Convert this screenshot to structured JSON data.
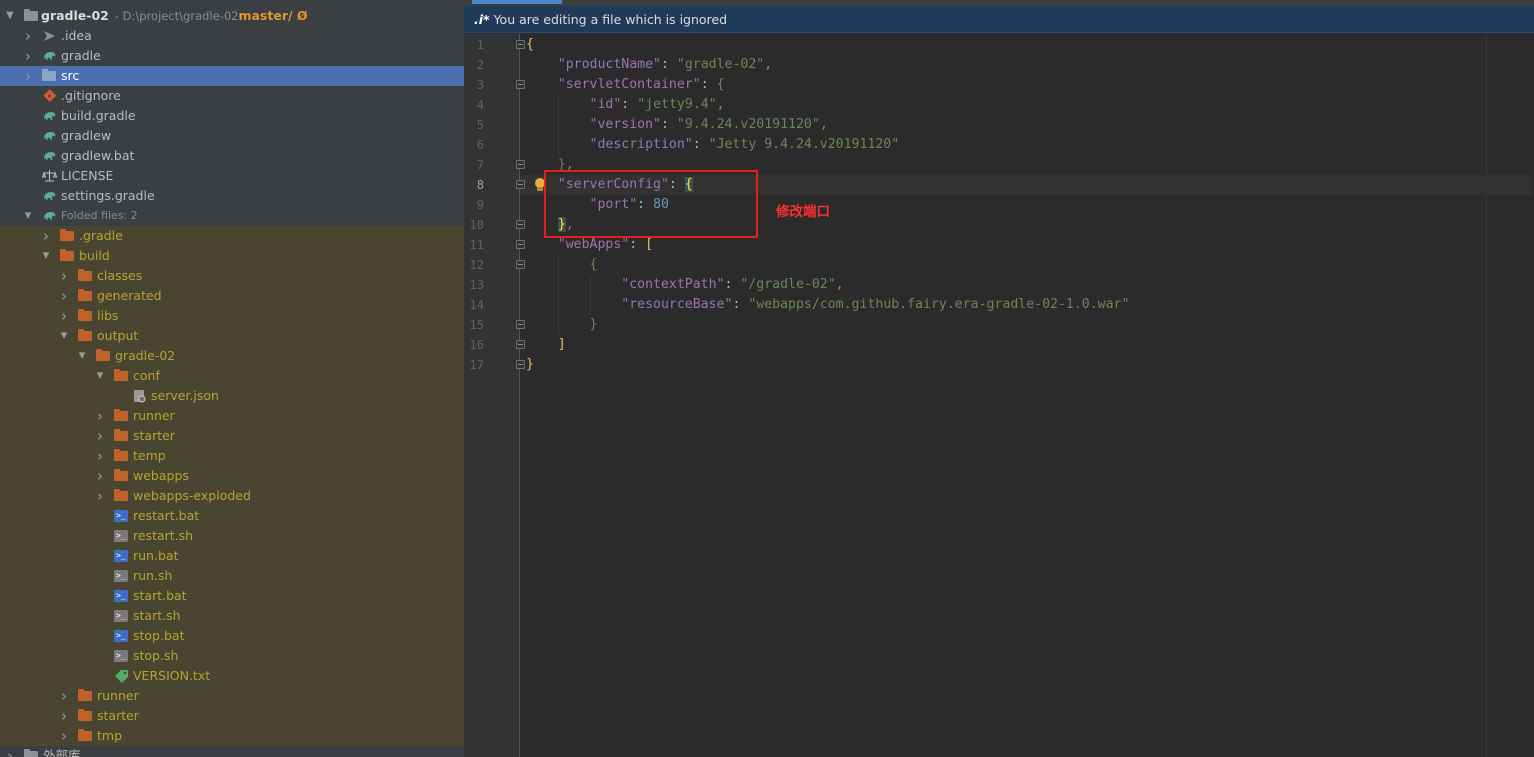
{
  "project": {
    "name": "gradle-02",
    "path": "- D:\\project\\gradle-02",
    "branch": "master/ Ø"
  },
  "tree": [
    {
      "label": ".idea",
      "indent": 1,
      "arrow": "right",
      "icon": "idea-folder-icon",
      "ignored": false
    },
    {
      "label": "gradle",
      "indent": 1,
      "arrow": "right",
      "icon": "gradle-elephant-icon",
      "ignored": false
    },
    {
      "label": "src",
      "indent": 1,
      "arrow": "right",
      "icon": "folder-icon",
      "ignored": false,
      "selected": true
    },
    {
      "label": ".gitignore",
      "indent": 1,
      "arrow": "",
      "icon": "git-file-icon",
      "ignored": false
    },
    {
      "label": "build.gradle",
      "indent": 1,
      "arrow": "",
      "icon": "gradle-elephant-icon",
      "ignored": false
    },
    {
      "label": "gradlew",
      "indent": 1,
      "arrow": "",
      "icon": "gradle-elephant-icon",
      "ignored": false
    },
    {
      "label": "gradlew.bat",
      "indent": 1,
      "arrow": "",
      "icon": "gradle-elephant-icon",
      "ignored": false
    },
    {
      "label": "LICENSE",
      "indent": 1,
      "arrow": "",
      "icon": "license-scale-icon",
      "ignored": false
    },
    {
      "label": "settings.gradle",
      "indent": 1,
      "arrow": "",
      "icon": "gradle-elephant-icon",
      "ignored": false
    },
    {
      "label": "Folded files: 2",
      "indent": 1,
      "arrow": "down",
      "icon": "gradle-elephant-icon",
      "ignored": false,
      "dim": true
    },
    {
      "label": ".gradle",
      "indent": 2,
      "arrow": "right",
      "icon": "folder-orange-icon",
      "ignored": true
    },
    {
      "label": "build",
      "indent": 2,
      "arrow": "down",
      "icon": "folder-orange-icon",
      "ignored": true
    },
    {
      "label": "classes",
      "indent": 3,
      "arrow": "right",
      "icon": "folder-orange-icon",
      "ignored": true
    },
    {
      "label": "generated",
      "indent": 3,
      "arrow": "right",
      "icon": "folder-orange-icon",
      "ignored": true
    },
    {
      "label": "libs",
      "indent": 3,
      "arrow": "right",
      "icon": "folder-orange-icon",
      "ignored": true
    },
    {
      "label": "output",
      "indent": 3,
      "arrow": "down",
      "icon": "folder-orange-icon",
      "ignored": true
    },
    {
      "label": "gradle-02",
      "indent": 4,
      "arrow": "down",
      "icon": "folder-orange-icon",
      "ignored": true
    },
    {
      "label": "conf",
      "indent": 5,
      "arrow": "down",
      "icon": "folder-orange-icon",
      "ignored": true
    },
    {
      "label": "server.json",
      "indent": 6,
      "arrow": "",
      "icon": "json-config-icon",
      "ignored": true
    },
    {
      "label": "runner",
      "indent": 5,
      "arrow": "right",
      "icon": "folder-orange-icon",
      "ignored": true
    },
    {
      "label": "starter",
      "indent": 5,
      "arrow": "right",
      "icon": "folder-orange-icon",
      "ignored": true
    },
    {
      "label": "temp",
      "indent": 5,
      "arrow": "right",
      "icon": "folder-orange-icon",
      "ignored": true
    },
    {
      "label": "webapps",
      "indent": 5,
      "arrow": "right",
      "icon": "folder-orange-icon",
      "ignored": true
    },
    {
      "label": "webapps-exploded",
      "indent": 5,
      "arrow": "right",
      "icon": "folder-orange-icon",
      "ignored": true
    },
    {
      "label": "restart.bat",
      "indent": 5,
      "arrow": "",
      "icon": "bat-script-icon",
      "ignored": true
    },
    {
      "label": "restart.sh",
      "indent": 5,
      "arrow": "",
      "icon": "shell-script-icon",
      "ignored": true
    },
    {
      "label": "run.bat",
      "indent": 5,
      "arrow": "",
      "icon": "bat-script-icon",
      "ignored": true
    },
    {
      "label": "run.sh",
      "indent": 5,
      "arrow": "",
      "icon": "shell-script-icon",
      "ignored": true
    },
    {
      "label": "start.bat",
      "indent": 5,
      "arrow": "",
      "icon": "bat-script-icon",
      "ignored": true
    },
    {
      "label": "start.sh",
      "indent": 5,
      "arrow": "",
      "icon": "shell-script-icon",
      "ignored": true
    },
    {
      "label": "stop.bat",
      "indent": 5,
      "arrow": "",
      "icon": "bat-script-icon",
      "ignored": true
    },
    {
      "label": "stop.sh",
      "indent": 5,
      "arrow": "",
      "icon": "shell-script-icon",
      "ignored": true
    },
    {
      "label": "VERSION.txt",
      "indent": 5,
      "arrow": "",
      "icon": "text-tag-icon",
      "ignored": true
    },
    {
      "label": "runner",
      "indent": 3,
      "arrow": "right",
      "icon": "folder-orange-icon",
      "ignored": true
    },
    {
      "label": "starter",
      "indent": 3,
      "arrow": "right",
      "icon": "folder-orange-icon",
      "ignored": true
    },
    {
      "label": "tmp",
      "indent": 3,
      "arrow": "right",
      "icon": "folder-orange-icon",
      "ignored": true
    },
    {
      "label": "外部库",
      "indent": 0,
      "arrow": "right",
      "icon": "library-icon",
      "ignored": false
    }
  ],
  "editor": {
    "banner_mark": ".i*",
    "banner_text": "You are editing a file which is ignored",
    "current_line": 8,
    "lines": [
      {
        "n": "1",
        "t": [
          [
            "b1",
            "{"
          ]
        ]
      },
      {
        "n": "2",
        "t": [
          [
            "t",
            "    "
          ],
          [
            "k",
            "\"productName\""
          ],
          [
            "t",
            ": "
          ],
          [
            "s",
            "\"gradle-02\""
          ],
          [
            "p",
            ","
          ]
        ]
      },
      {
        "n": "3",
        "t": [
          [
            "t",
            "    "
          ],
          [
            "k",
            "\"servletContainer\""
          ],
          [
            "t",
            ": "
          ],
          [
            "b2",
            "{"
          ]
        ]
      },
      {
        "n": "4",
        "t": [
          [
            "t",
            "        "
          ],
          [
            "k",
            "\"id\""
          ],
          [
            "t",
            ": "
          ],
          [
            "s",
            "\"jetty9.4\""
          ],
          [
            "p",
            ","
          ]
        ]
      },
      {
        "n": "5",
        "t": [
          [
            "t",
            "        "
          ],
          [
            "k",
            "\"version\""
          ],
          [
            "t",
            ": "
          ],
          [
            "s",
            "\"9.4.24.v20191120\""
          ],
          [
            "p",
            ","
          ]
        ]
      },
      {
        "n": "6",
        "t": [
          [
            "t",
            "        "
          ],
          [
            "k",
            "\"description\""
          ],
          [
            "t",
            ": "
          ],
          [
            "s",
            "\"Jetty 9.4.24.v20191120\""
          ]
        ]
      },
      {
        "n": "7",
        "t": [
          [
            "t",
            "    "
          ],
          [
            "b2",
            "}"
          ],
          [
            "p",
            ","
          ]
        ]
      },
      {
        "n": "8",
        "t": [
          [
            "t",
            "    "
          ],
          [
            "k",
            "\"serverConfig\""
          ],
          [
            "t",
            ": "
          ],
          [
            "bmatch",
            "{"
          ]
        ]
      },
      {
        "n": "9",
        "t": [
          [
            "t",
            "        "
          ],
          [
            "k",
            "\"port\""
          ],
          [
            "t",
            ": "
          ],
          [
            "n",
            "80"
          ]
        ]
      },
      {
        "n": "10",
        "t": [
          [
            "t",
            "    "
          ],
          [
            "bmatch",
            "}"
          ],
          [
            "p",
            ","
          ]
        ]
      },
      {
        "n": "11",
        "t": [
          [
            "t",
            "    "
          ],
          [
            "k",
            "\"webApps\""
          ],
          [
            "t",
            ": "
          ],
          [
            "b1",
            "["
          ]
        ]
      },
      {
        "n": "12",
        "t": [
          [
            "t",
            "        "
          ],
          [
            "b2",
            "{"
          ]
        ]
      },
      {
        "n": "13",
        "t": [
          [
            "t",
            "            "
          ],
          [
            "k",
            "\"contextPath\""
          ],
          [
            "t",
            ": "
          ],
          [
            "s",
            "\"/gradle-02\""
          ],
          [
            "p",
            ","
          ]
        ]
      },
      {
        "n": "14",
        "t": [
          [
            "t",
            "            "
          ],
          [
            "k",
            "\"resourceBase\""
          ],
          [
            "t",
            ": "
          ],
          [
            "s",
            "\"webapps/com.github.fairy.era-gradle-02-1.0.war\""
          ]
        ]
      },
      {
        "n": "15",
        "t": [
          [
            "t",
            "        "
          ],
          [
            "b2",
            "}"
          ]
        ]
      },
      {
        "n": "16",
        "t": [
          [
            "t",
            "    "
          ],
          [
            "b1",
            "]"
          ]
        ]
      },
      {
        "n": "17",
        "t": [
          [
            "b1",
            "}"
          ]
        ]
      }
    ],
    "fold_lines": [
      1,
      3,
      7,
      8,
      10,
      11,
      12,
      15,
      16,
      17
    ]
  },
  "annotation": {
    "text": "修改端口",
    "color": "#e0201e"
  },
  "colors": {
    "tree_bg": "#3c3f41",
    "ignored_row_bg": "#4a4530",
    "ignored_text": "#b5a432",
    "selection": "#4b6eaf",
    "editor_bg": "#2b2b2b",
    "json_key": "#9876aa",
    "json_string": "#6a8759",
    "json_number": "#6897bb"
  }
}
